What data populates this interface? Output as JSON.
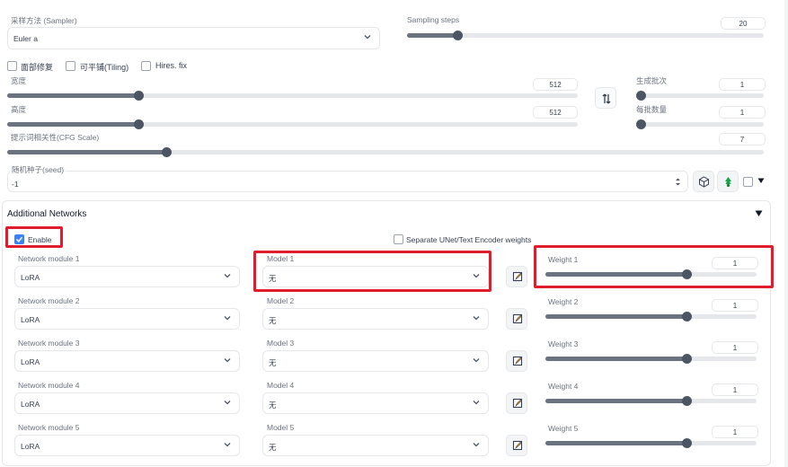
{
  "sampler": {
    "label": "采样方法 (Sampler)",
    "value": "Euler a"
  },
  "steps": {
    "label": "Sampling steps",
    "value": "20",
    "fraction": 0.14
  },
  "checks": {
    "face": "面部修复",
    "tiling": "可平铺(Tiling)",
    "hires": "Hires. fix"
  },
  "width": {
    "label": "宽度",
    "value": "512",
    "fraction": 0.23
  },
  "height": {
    "label": "高度",
    "value": "512",
    "fraction": 0.23
  },
  "batch_count": {
    "label": "生成批次",
    "value": "1",
    "fraction": 0.0
  },
  "batch_size": {
    "label": "每批数量",
    "value": "1",
    "fraction": 0.0
  },
  "cfg": {
    "label": "提示词相关性(CFG Scale)",
    "value": "7",
    "fraction": 0.21
  },
  "seed": {
    "label": "随机种子(seed)",
    "value": "-1"
  },
  "addnet": {
    "title": "Additional Networks",
    "enable_label": "Enable",
    "enable_checked": true,
    "separate_label": "Separate UNet/Text Encoder weights",
    "rows": [
      {
        "module_label": "Network module 1",
        "module_value": "LoRA",
        "model_label": "Model 1",
        "model_value": "无",
        "weight_label": "Weight 1",
        "weight_value": "1",
        "weight_fraction": 0.67
      },
      {
        "module_label": "Network module 2",
        "module_value": "LoRA",
        "model_label": "Model 2",
        "model_value": "无",
        "weight_label": "Weight 2",
        "weight_value": "1",
        "weight_fraction": 0.67
      },
      {
        "module_label": "Network module 3",
        "module_value": "LoRA",
        "model_label": "Model 3",
        "model_value": "无",
        "weight_label": "Weight 3",
        "weight_value": "1",
        "weight_fraction": 0.67
      },
      {
        "module_label": "Network module 4",
        "module_value": "LoRA",
        "model_label": "Model 4",
        "model_value": "无",
        "weight_label": "Weight 4",
        "weight_value": "1",
        "weight_fraction": 0.67
      },
      {
        "module_label": "Network module 5",
        "module_value": "LoRA",
        "model_label": "Model 5",
        "model_value": "无",
        "weight_label": "Weight 5",
        "weight_value": "1",
        "weight_fraction": 0.67
      }
    ]
  },
  "colors": {
    "highlight": "#e11d2d",
    "checkbox": "#3b82f6",
    "slider": "#6b7280"
  }
}
